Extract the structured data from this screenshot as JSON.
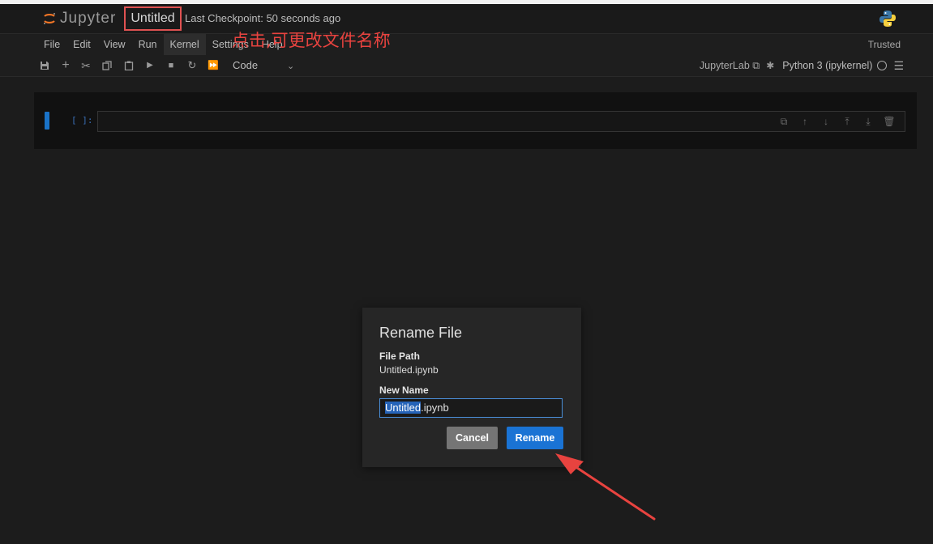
{
  "header": {
    "logo_text": "Jupyter",
    "notebook_title": "Untitled",
    "checkpoint": "Last Checkpoint: 50 seconds ago"
  },
  "menu": {
    "items": [
      "File",
      "Edit",
      "View",
      "Run",
      "Kernel",
      "Settings",
      "Help"
    ],
    "trusted": "Trusted"
  },
  "annotation": {
    "text": "点击,可更改文件名称",
    "color": "#e8433f"
  },
  "toolbar": {
    "icons": [
      "save-icon",
      "add-cell-icon",
      "cut-icon",
      "copy-icon",
      "paste-icon",
      "run-icon",
      "stop-icon",
      "restart-icon",
      "run-all-icon"
    ],
    "cell_type": "Code",
    "jupyterlab_link": "JupyterLab",
    "kernel_name": "Python 3 (ipykernel)"
  },
  "cell": {
    "prompt": "[ ]:",
    "tools": [
      "duplicate-icon",
      "move-up-icon",
      "move-down-icon",
      "insert-above-icon",
      "insert-below-icon",
      "delete-icon"
    ]
  },
  "dialog": {
    "title": "Rename File",
    "file_path_label": "File Path",
    "file_path_value": "Untitled.ipynb",
    "new_name_label": "New Name",
    "new_name_selected": "Untitled",
    "new_name_rest": ".ipynb",
    "cancel_label": "Cancel",
    "rename_label": "Rename"
  },
  "colors": {
    "accent": "#1a73d4",
    "highlight_box": "#e05252",
    "background": "#1c1c1c"
  }
}
